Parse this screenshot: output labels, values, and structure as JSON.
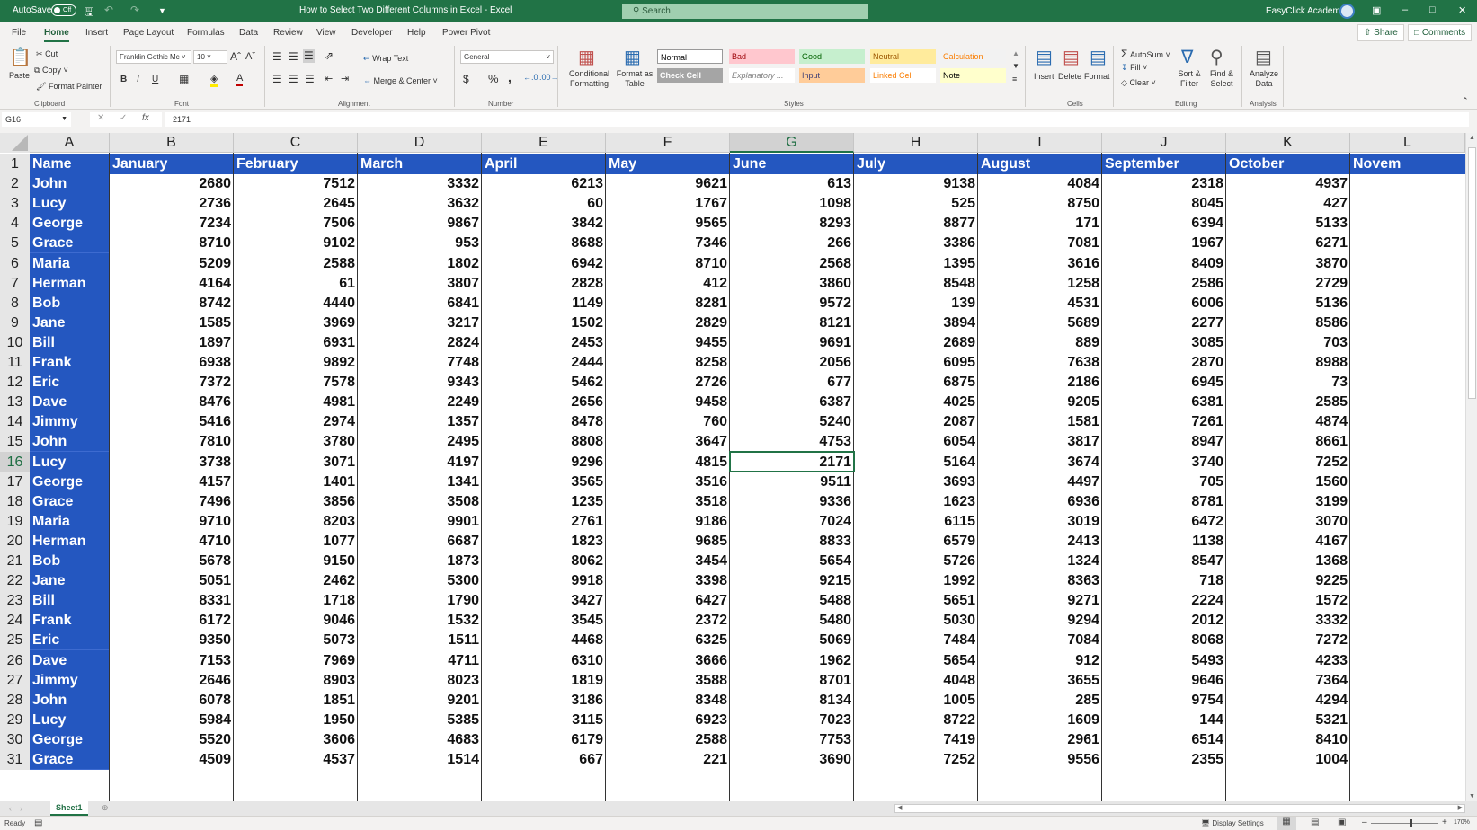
{
  "titlebar": {
    "autosave_label": "AutoSave",
    "autosave_state": "Off",
    "document_title": "How to Select Two Different Columns in Excel  -  Excel",
    "search_placeholder": "Search",
    "user_name": "EasyClick Academy",
    "icons": [
      "save-icon",
      "undo-icon",
      "redo-icon",
      "customize-qat-icon",
      "ribbon-display-icon",
      "minimize-icon",
      "restore-icon",
      "close-icon"
    ]
  },
  "tabs": [
    "File",
    "Home",
    "Insert",
    "Page Layout",
    "Formulas",
    "Data",
    "Review",
    "View",
    "Developer",
    "Help",
    "Power Pivot"
  ],
  "active_tab": "Home",
  "share_label": "Share",
  "comments_label": "Comments",
  "ribbon": {
    "clipboard": {
      "label": "Clipboard",
      "paste": "Paste",
      "cut": "Cut",
      "copy": "Copy",
      "format_painter": "Format Painter"
    },
    "font": {
      "label": "Font",
      "font_name": "Franklin Gothic Mc",
      "font_size": "10",
      "bold": "B",
      "italic": "I",
      "underline": "U"
    },
    "alignment": {
      "label": "Alignment",
      "wrap_text": "Wrap Text",
      "merge_center": "Merge & Center"
    },
    "number": {
      "label": "Number",
      "format": "General",
      "currency": "$",
      "percent": "%",
      "comma": ","
    },
    "styles": {
      "label": "Styles",
      "conditional_formatting": "Conditional Formatting",
      "format_as_table": "Format as Table",
      "cells": [
        {
          "name": "Normal",
          "bg": "#ffffff",
          "fg": "#000000"
        },
        {
          "name": "Bad",
          "bg": "#ffc7ce",
          "fg": "#9c0006"
        },
        {
          "name": "Good",
          "bg": "#c6efce",
          "fg": "#006100"
        },
        {
          "name": "Neutral",
          "bg": "#ffeb9c",
          "fg": "#9c5700"
        },
        {
          "name": "Calculation",
          "bg": "#f2f2f2",
          "fg": "#fa7d00"
        },
        {
          "name": "Check Cell",
          "bg": "#a5a5a5",
          "fg": "#ffffff"
        },
        {
          "name": "Explanatory ...",
          "bg": "#ffffff",
          "fg": "#7f7f7f"
        },
        {
          "name": "Input",
          "bg": "#ffcc99",
          "fg": "#3f3f76"
        },
        {
          "name": "Linked Cell",
          "bg": "#ffffff",
          "fg": "#fa7d00"
        },
        {
          "name": "Note",
          "bg": "#ffffcc",
          "fg": "#000000"
        }
      ]
    },
    "cells": {
      "label": "Cells",
      "insert": "Insert",
      "delete": "Delete",
      "format": "Format"
    },
    "editing": {
      "label": "Editing",
      "autosum": "AutoSum",
      "fill": "Fill",
      "clear": "Clear",
      "sort_filter": "Sort & Filter",
      "find_select": "Find & Select"
    },
    "analysis": {
      "label": "Analysis",
      "analyze_data": "Analyze Data"
    }
  },
  "formula_bar": {
    "name_box": "G16",
    "value": "2171"
  },
  "sheet": {
    "columns": [
      "A",
      "B",
      "C",
      "D",
      "E",
      "F",
      "G",
      "H",
      "I",
      "J",
      "K",
      "L"
    ],
    "selected_column": "G",
    "selected_row": 16,
    "headers": [
      "Name",
      "January",
      "February",
      "March",
      "April",
      "May",
      "June",
      "July",
      "August",
      "September",
      "October",
      "Novem"
    ],
    "rows": [
      [
        "John",
        2680,
        7512,
        3332,
        6213,
        9621,
        613,
        9138,
        4084,
        2318,
        4937
      ],
      [
        "Lucy",
        2736,
        2645,
        3632,
        60,
        1767,
        1098,
        525,
        8750,
        8045,
        427
      ],
      [
        "George",
        7234,
        7506,
        9867,
        3842,
        9565,
        8293,
        8877,
        171,
        6394,
        5133
      ],
      [
        "Grace",
        8710,
        9102,
        953,
        8688,
        7346,
        266,
        3386,
        7081,
        1967,
        6271
      ],
      [
        "Maria",
        5209,
        2588,
        1802,
        6942,
        8710,
        2568,
        1395,
        3616,
        8409,
        3870
      ],
      [
        "Herman",
        4164,
        61,
        3807,
        2828,
        412,
        3860,
        8548,
        1258,
        2586,
        2729
      ],
      [
        "Bob",
        8742,
        4440,
        6841,
        1149,
        8281,
        9572,
        139,
        4531,
        6006,
        5136
      ],
      [
        "Jane",
        1585,
        3969,
        3217,
        1502,
        2829,
        8121,
        3894,
        5689,
        2277,
        8586
      ],
      [
        "Bill",
        1897,
        6931,
        2824,
        2453,
        9455,
        9691,
        2689,
        889,
        3085,
        703
      ],
      [
        "Frank",
        6938,
        9892,
        7748,
        2444,
        8258,
        2056,
        6095,
        7638,
        2870,
        8988
      ],
      [
        "Eric",
        7372,
        7578,
        9343,
        5462,
        2726,
        677,
        6875,
        2186,
        6945,
        73
      ],
      [
        "Dave",
        8476,
        4981,
        2249,
        2656,
        9458,
        6387,
        4025,
        9205,
        6381,
        2585
      ],
      [
        "Jimmy",
        5416,
        2974,
        1357,
        8478,
        760,
        5240,
        2087,
        1581,
        7261,
        4874
      ],
      [
        "John",
        7810,
        3780,
        2495,
        8808,
        3647,
        4753,
        6054,
        3817,
        8947,
        8661
      ],
      [
        "Lucy",
        3738,
        3071,
        4197,
        9296,
        4815,
        2171,
        5164,
        3674,
        3740,
        7252
      ],
      [
        "George",
        4157,
        1401,
        1341,
        3565,
        3516,
        9511,
        3693,
        4497,
        705,
        1560
      ],
      [
        "Grace",
        7496,
        3856,
        3508,
        1235,
        3518,
        9336,
        1623,
        6936,
        8781,
        3199
      ],
      [
        "Maria",
        9710,
        8203,
        9901,
        2761,
        9186,
        7024,
        6115,
        3019,
        6472,
        3070
      ],
      [
        "Herman",
        4710,
        1077,
        6687,
        1823,
        9685,
        8833,
        6579,
        2413,
        1138,
        4167
      ],
      [
        "Bob",
        5678,
        9150,
        1873,
        8062,
        3454,
        5654,
        5726,
        1324,
        8547,
        1368
      ],
      [
        "Jane",
        5051,
        2462,
        5300,
        9918,
        3398,
        9215,
        1992,
        8363,
        718,
        9225
      ],
      [
        "Bill",
        8331,
        1718,
        1790,
        3427,
        6427,
        5488,
        5651,
        9271,
        2224,
        1572
      ],
      [
        "Frank",
        6172,
        9046,
        1532,
        3545,
        2372,
        5480,
        5030,
        9294,
        2012,
        3332
      ],
      [
        "Eric",
        9350,
        5073,
        1511,
        4468,
        6325,
        5069,
        7484,
        7084,
        8068,
        7272
      ],
      [
        "Dave",
        7153,
        7969,
        4711,
        6310,
        3666,
        1962,
        5654,
        912,
        5493,
        4233
      ],
      [
        "Jimmy",
        2646,
        8903,
        8023,
        1819,
        3588,
        8701,
        4048,
        3655,
        9646,
        7364
      ],
      [
        "John",
        6078,
        1851,
        9201,
        3186,
        8348,
        8134,
        1005,
        285,
        9754,
        4294
      ],
      [
        "Lucy",
        5984,
        1950,
        5385,
        3115,
        6923,
        7023,
        8722,
        1609,
        144,
        5321
      ],
      [
        "George",
        5520,
        3606,
        4683,
        6179,
        2588,
        7753,
        7419,
        2961,
        6514,
        8410
      ],
      [
        "Grace",
        4509,
        4537,
        1514,
        667,
        221,
        3690,
        7252,
        9556,
        2355,
        1004
      ]
    ]
  },
  "sheet_tabs": [
    "Sheet1"
  ],
  "status": {
    "ready": "Ready",
    "display_settings": "Display Settings",
    "zoom": "170%"
  }
}
